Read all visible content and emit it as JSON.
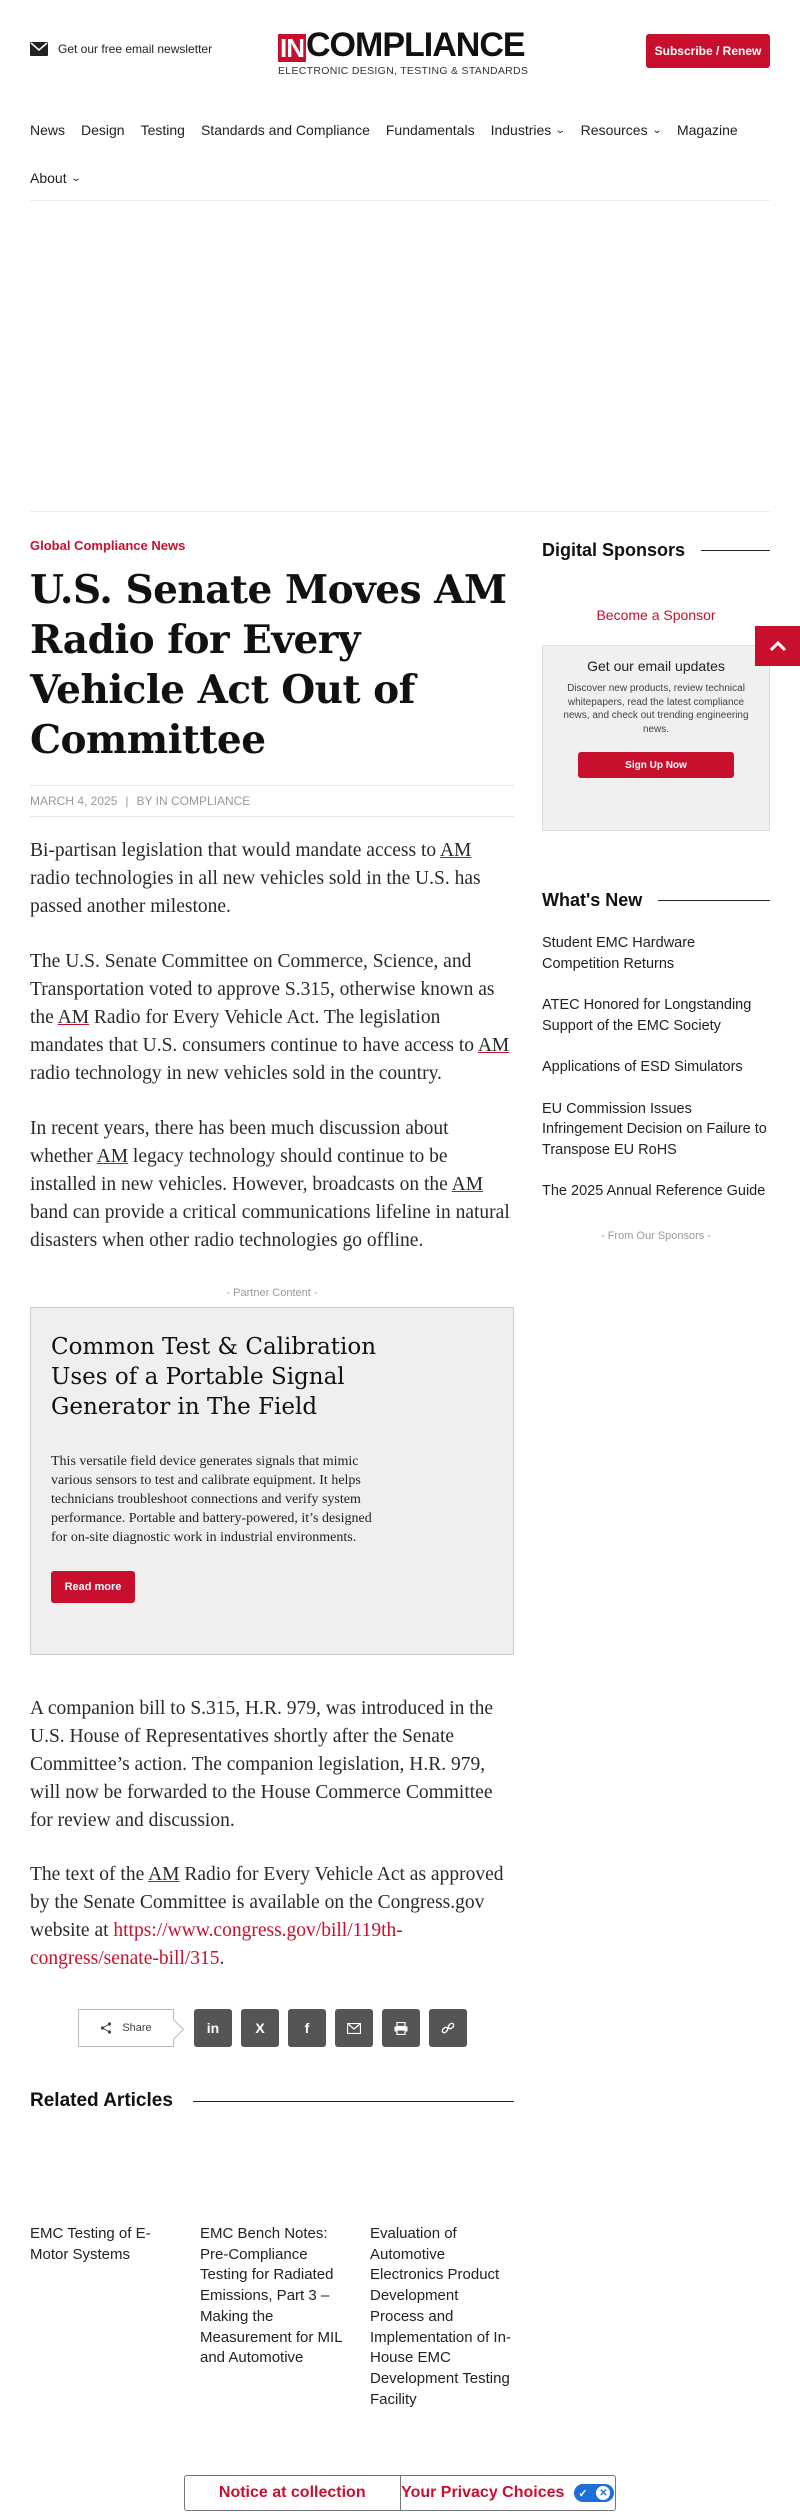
{
  "header": {
    "newsletter_label": "Get our free email newsletter",
    "logo_in": "IN",
    "logo_main": "COMPLIANCE",
    "logo_tagline": "ELECTRONIC DESIGN, TESTING & STANDARDS",
    "subscribe_label": "Subscribe / Renew"
  },
  "nav": {
    "items": [
      "News",
      "Design",
      "Testing",
      "Standards and Compliance",
      "Fundamentals",
      "Industries",
      "Resources",
      "Magazine",
      "About"
    ]
  },
  "article": {
    "category": "Global Compliance News",
    "title": "U.S. Senate Moves AM Radio for Every Vehicle Act Out of Committee",
    "date": "MARCH 4, 2025",
    "separator": "|",
    "byline": "BY IN COMPLIANCE",
    "p1": {
      "a": "Bi-partisan legislation that would mandate access to ",
      "am": "AM",
      "b": " radio technologies in all new vehicles sold in the U.S. has passed another milestone."
    },
    "p2": {
      "a": "The U.S. Senate Committee on Commerce, Science, and Transportation voted to approve S.315, otherwise known as the ",
      "am1": "AM",
      "b": " Radio for Every Vehicle Act. The legislation mandates that U.S. consumers continue to have access to ",
      "am2": "AM",
      "c": " radio technology in new vehicles sold in the country."
    },
    "p3": {
      "a": "In recent years, there has been much discussion about whether ",
      "am1": "AM",
      "b": " legacy technology should continue to be installed in new vehicles. However, broadcasts on the ",
      "am2": "AM",
      "c": " band can provide a critical communications lifeline in natural disasters when other radio technologies go offline."
    },
    "p4": "A companion bill to S.315, H.R. 979, was introduced in the U.S. House of Representatives shortly after the Senate Committee’s action. The companion legislation, H.R. 979, will now be forwarded to the House Commerce Committee for review and discussion.",
    "p5": {
      "a": " The text of the ",
      "am": "AM",
      "b": " Radio for Every Vehicle Act as approved by the Senate Committee is available on the Congress.gov website at ",
      "link": "https://www.congress.gov/bill/119th-congress/senate-bill/315",
      "end": "."
    }
  },
  "partner": {
    "label": "- Partner Content -",
    "title": "Common Test & Calibration Uses of a Portable Signal Generator in The Field",
    "description": "This versatile field device generates signals that mimic various sensors to test and calibrate equipment. It helps technicians troubleshoot connections and verify system performance. Portable and battery-powered, it’s designed for on-site diagnostic work in industrial environments.",
    "button": "Read more"
  },
  "share": {
    "label": "Share",
    "icons": [
      "in",
      "X",
      "f",
      "email",
      "print",
      "link"
    ]
  },
  "related": {
    "heading": "Related Articles",
    "items": [
      "EMC Testing of E-Motor Systems",
      "EMC Bench Notes: Pre-Compliance Testing for Radiated Emissions, Part 3 – Making the Measurement for MIL and Automotive",
      "Evaluation of Automotive Electronics Product Development Process and Implementation of In-House EMC Development Testing Facility"
    ]
  },
  "sidebar": {
    "sponsors_heading": "Digital Sponsors",
    "become_sponsor": "Become a Sponsor",
    "email_box": {
      "title": "Get our email updates",
      "text": "Discover new products, review technical whitepapers, read the latest compliance news, and check out trending engineering news.",
      "button": "Sign Up Now"
    },
    "whatsnew_heading": "What's New",
    "whatsnew_items": [
      "Student EMC Hardware Competition Returns",
      "ATEC Honored for Longstanding Support of the EMC Society",
      "Applications of ESD Simulators",
      "EU Commission Issues Infringement Decision on Failure to Transpose EU RoHS",
      "The 2025 Annual Reference Guide"
    ],
    "from_sponsors": "- From Our Sponsors -"
  },
  "consent": {
    "notice": "Notice at collection",
    "privacy": "Your Privacy Choices"
  },
  "colors": {
    "brand_red": "#c8102e",
    "toggle_blue": "#1e6fd9"
  }
}
